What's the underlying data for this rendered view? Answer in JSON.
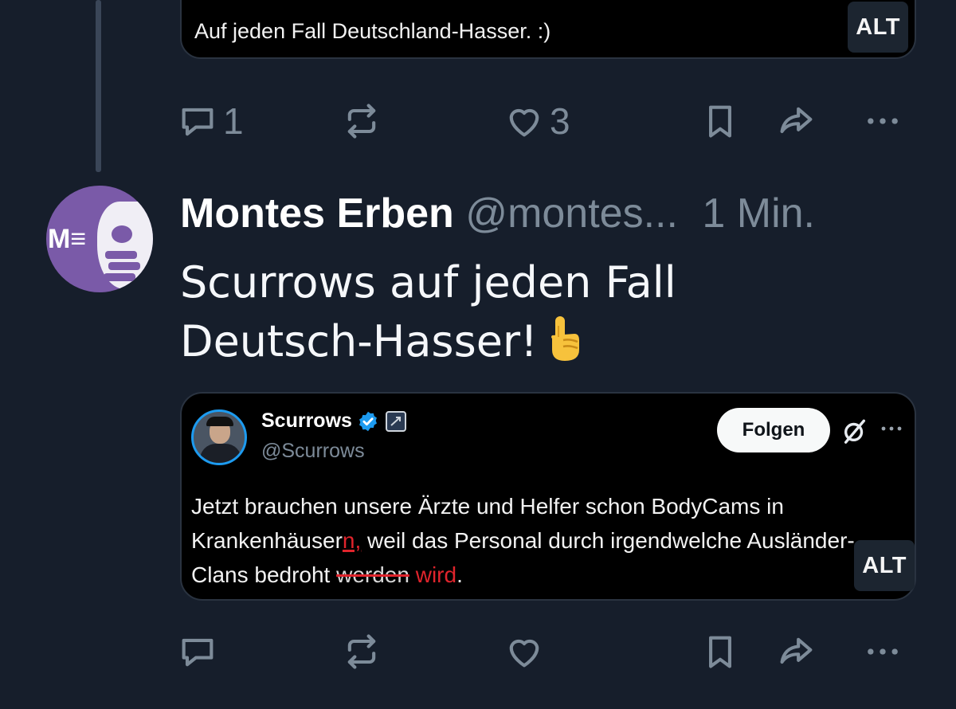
{
  "top_card": {
    "caption": "Auf jeden Fall Deutschland-Hasser. :)",
    "alt_label": "ALT"
  },
  "top_actions": {
    "reply_count": "1",
    "like_count": "3"
  },
  "post": {
    "author_name": "Montes Erben",
    "handle": "@montes...",
    "time": "1 Min.",
    "avatar_mark": "M≡",
    "text_line1": "Scurrows auf jeden Fall",
    "text_line2": "Deutsch-Hasser!",
    "emoji": "☝️"
  },
  "embed": {
    "name": "Scurrows",
    "handle": "@Scurrows",
    "follow_label": "Folgen",
    "text_part1": "Jetzt brauchen unsere Ärzte und Helfer schon BodyCams in Krankenhäuser",
    "text_insert": "n,",
    "text_part2": " weil das Personal durch irgendwelche Ausländer-Clans bedroht ",
    "text_struck": "werden",
    "text_correction": " wird",
    "text_end": ".",
    "alt_label": "ALT"
  },
  "icons": {
    "reply": "reply-icon",
    "repost": "repost-icon",
    "like": "heart-icon",
    "bookmark": "bookmark-icon",
    "share": "share-icon",
    "more": "more-icon",
    "verified": "verified-badge-icon",
    "affiliation": "affiliation-badge-icon",
    "grok": "grok-icon"
  },
  "colors": {
    "background": "#161e2b",
    "card": "#000000",
    "muted": "#7d8b99",
    "verified_blue": "#1d9bf0",
    "correction_red": "#e0242c",
    "avatar_purple": "#7a5aa8"
  }
}
